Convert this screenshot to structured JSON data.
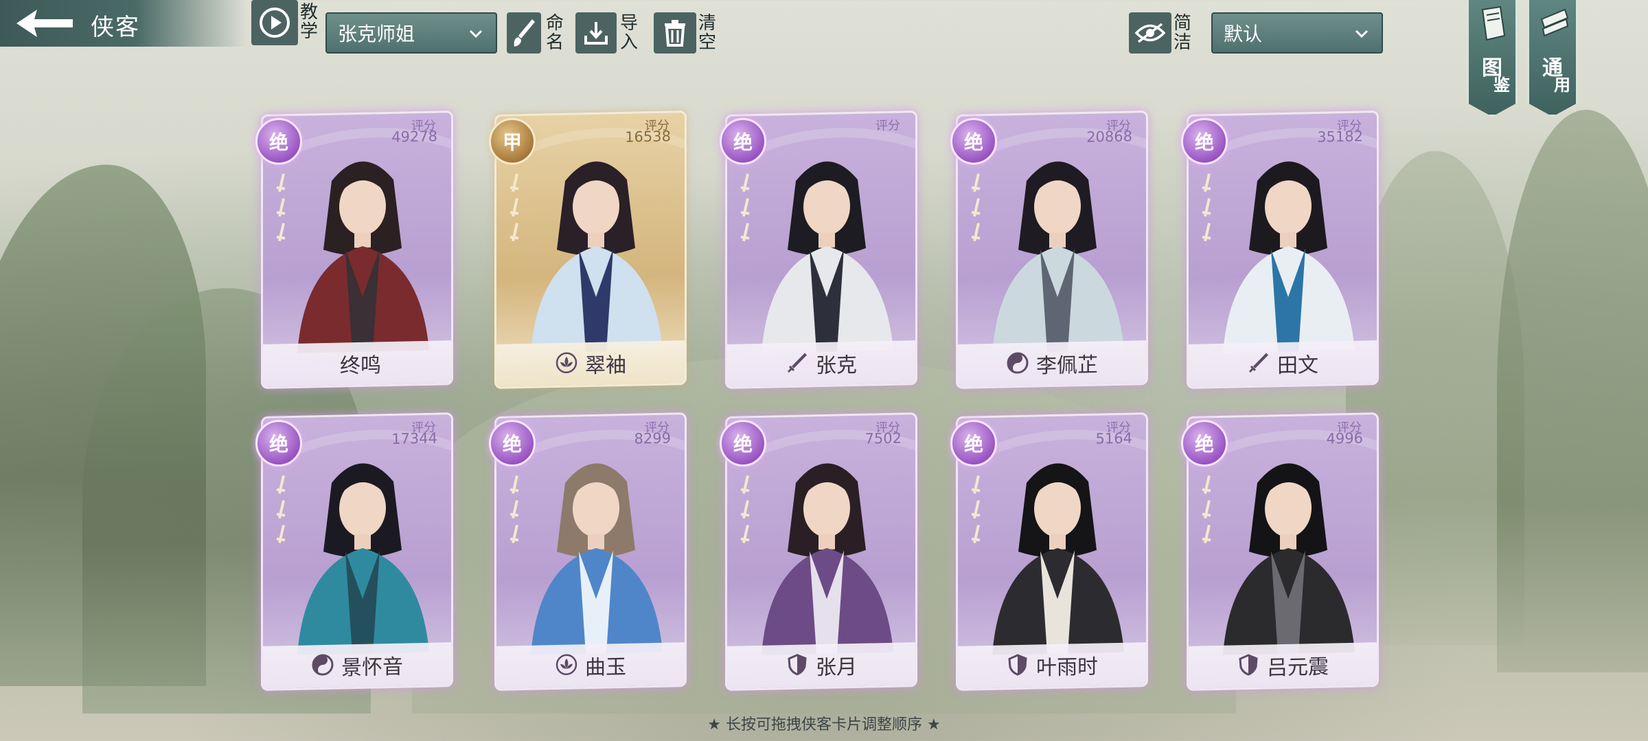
{
  "header": {
    "title": "侠客",
    "tutorial_label": "教学",
    "team_select": "张克师姐",
    "rename_label": "命名",
    "import_label": "导入",
    "clear_label": "清空",
    "concise_label": "简洁",
    "sort_select": "默认",
    "side_tabs": [
      {
        "label_top": "图",
        "label_bottom": "鉴"
      },
      {
        "label_top": "通",
        "label_bottom": "用"
      }
    ]
  },
  "score_label": "评分",
  "cards": [
    {
      "name": "终鸣",
      "score": "49278",
      "rarity": "绝",
      "type_icon": "none-icon",
      "theme": "purple"
    },
    {
      "name": "翠袖",
      "score": "16538",
      "rarity": "甲",
      "type_icon": "lotus-icon",
      "theme": "gold"
    },
    {
      "name": "张克",
      "score": "",
      "rarity": "绝",
      "type_icon": "sword-icon",
      "theme": "purple"
    },
    {
      "name": "李佩芷",
      "score": "20868",
      "rarity": "绝",
      "type_icon": "taiji-icon",
      "theme": "purple"
    },
    {
      "name": "田文",
      "score": "35182",
      "rarity": "绝",
      "type_icon": "sword-icon",
      "theme": "purple"
    },
    {
      "name": "景怀音",
      "score": "17344",
      "rarity": "绝",
      "type_icon": "taiji-icon",
      "theme": "purple"
    },
    {
      "name": "曲玉",
      "score": "8299",
      "rarity": "绝",
      "type_icon": "lotus-icon",
      "theme": "purple"
    },
    {
      "name": "张月",
      "score": "7502",
      "rarity": "绝",
      "type_icon": "shield-icon",
      "theme": "purple"
    },
    {
      "name": "叶雨时",
      "score": "5164",
      "rarity": "绝",
      "type_icon": "shield-icon",
      "theme": "purple"
    },
    {
      "name": "吕元震",
      "score": "4996",
      "rarity": "绝",
      "type_icon": "shield-icon",
      "theme": "purple"
    }
  ],
  "footer_hint": "★ 长按可拖拽侠客卡片调整顺序 ★",
  "colors": {
    "accent": "#4a6a66",
    "card_purple": "#b89fd1",
    "card_gold": "#d4b57d"
  }
}
